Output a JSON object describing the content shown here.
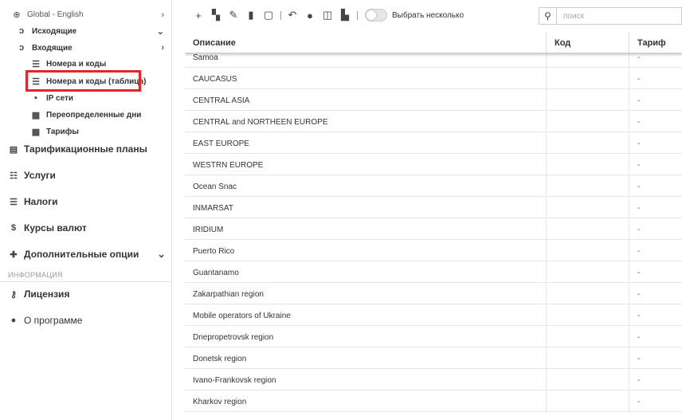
{
  "sidebar": {
    "tree": [
      {
        "label": "Global - English",
        "icon": "globe-icon"
      },
      {
        "label": "Исходящие",
        "icon": "phone-outgoing-icon"
      },
      {
        "label": "Входящие",
        "icon": "phone-incoming-icon"
      },
      {
        "label": "Номера и коды",
        "icon": "list-icon"
      },
      {
        "label": "Номера и коды (таблица)",
        "icon": "list-icon"
      },
      {
        "label": "IP сети",
        "icon": "network-icon"
      },
      {
        "label": "Переопределенные дни",
        "icon": "calendar-icon"
      },
      {
        "label": "Тарифы",
        "icon": "grid-icon"
      }
    ],
    "main": [
      {
        "label": "Тарификационные планы",
        "icon": "plan-icon"
      },
      {
        "label": "Услуги",
        "icon": "services-icon"
      },
      {
        "label": "Налоги",
        "icon": "taxes-icon"
      },
      {
        "label": "Курсы валют",
        "icon": "dollar-icon"
      },
      {
        "label": "Дополнительные опции",
        "icon": "plug-icon"
      }
    ],
    "section_title": "ИНФОРМАЦИЯ",
    "info": [
      {
        "label": "Лицензия",
        "icon": "key-icon"
      },
      {
        "label": "О программе",
        "icon": "info-icon"
      }
    ]
  },
  "toolbar": {
    "multi_select_label": "Выбрать несколько",
    "search_placeholder": "поиск"
  },
  "table": {
    "columns": [
      "Описание",
      "Код",
      "Тариф"
    ],
    "rows": [
      {
        "description": "Samoa",
        "code": "",
        "tariff": "-"
      },
      {
        "description": "CAUCASUS",
        "code": "",
        "tariff": "-"
      },
      {
        "description": "CENTRAL ASIA",
        "code": "",
        "tariff": "-"
      },
      {
        "description": "CENTRAL and NORTHEEN EUROPE",
        "code": "",
        "tariff": "-"
      },
      {
        "description": "EAST EUROPE",
        "code": "",
        "tariff": "-"
      },
      {
        "description": "WESTRN EUROPE",
        "code": "",
        "tariff": "-"
      },
      {
        "description": "Ocean Snac",
        "code": "",
        "tariff": "-"
      },
      {
        "description": "INMARSAT",
        "code": "",
        "tariff": "-"
      },
      {
        "description": "IRIDIUM",
        "code": "",
        "tariff": "-"
      },
      {
        "description": "Puerto Rico",
        "code": "",
        "tariff": "-"
      },
      {
        "description": "Guantanamo",
        "code": "",
        "tariff": "-"
      },
      {
        "description": "Zakarpathian region",
        "code": "",
        "tariff": "-"
      },
      {
        "description": "Mobile operators of Ukraine",
        "code": "",
        "tariff": "-"
      },
      {
        "description": "Dnepropetrovsk region",
        "code": "",
        "tariff": "-"
      },
      {
        "description": "Donetsk region",
        "code": "",
        "tariff": "-"
      },
      {
        "description": "Ivano-Frankovsk region",
        "code": "",
        "tariff": "-"
      },
      {
        "description": "Kharkov region",
        "code": "",
        "tariff": "-"
      }
    ]
  },
  "colors": {
    "highlight": "#e0252e"
  }
}
